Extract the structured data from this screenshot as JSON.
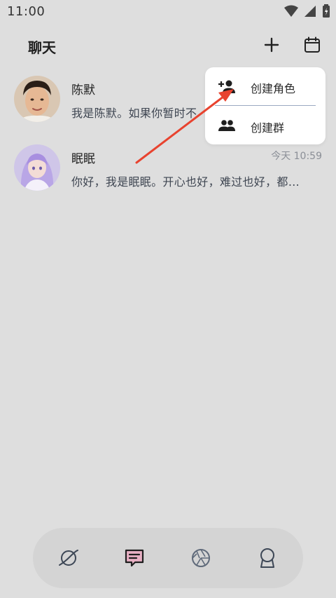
{
  "status_bar": {
    "time": "11:00"
  },
  "header": {
    "title": "聊天"
  },
  "chats": [
    {
      "name": "陈默",
      "preview": "我是陈默。如果你暂时不",
      "time": ""
    },
    {
      "name": "眠眠",
      "preview": "你好，我是眠眠。开心也好，难过也好，都…",
      "time": "今天 10:59"
    }
  ],
  "menu": {
    "items": [
      {
        "label": "创建角色",
        "icon": "add-person-icon"
      },
      {
        "label": "创建群",
        "icon": "group-icon"
      }
    ]
  },
  "bottom_nav": {
    "items": [
      {
        "icon": "planet-icon"
      },
      {
        "icon": "chat-message-icon",
        "active": true
      },
      {
        "icon": "aperture-icon"
      },
      {
        "icon": "profile-badge-icon"
      }
    ]
  },
  "colors": {
    "background": "#dedede",
    "menu_background": "#ffffff",
    "active_nav": "#e8b0c4",
    "annotation_arrow": "#e8432f"
  }
}
